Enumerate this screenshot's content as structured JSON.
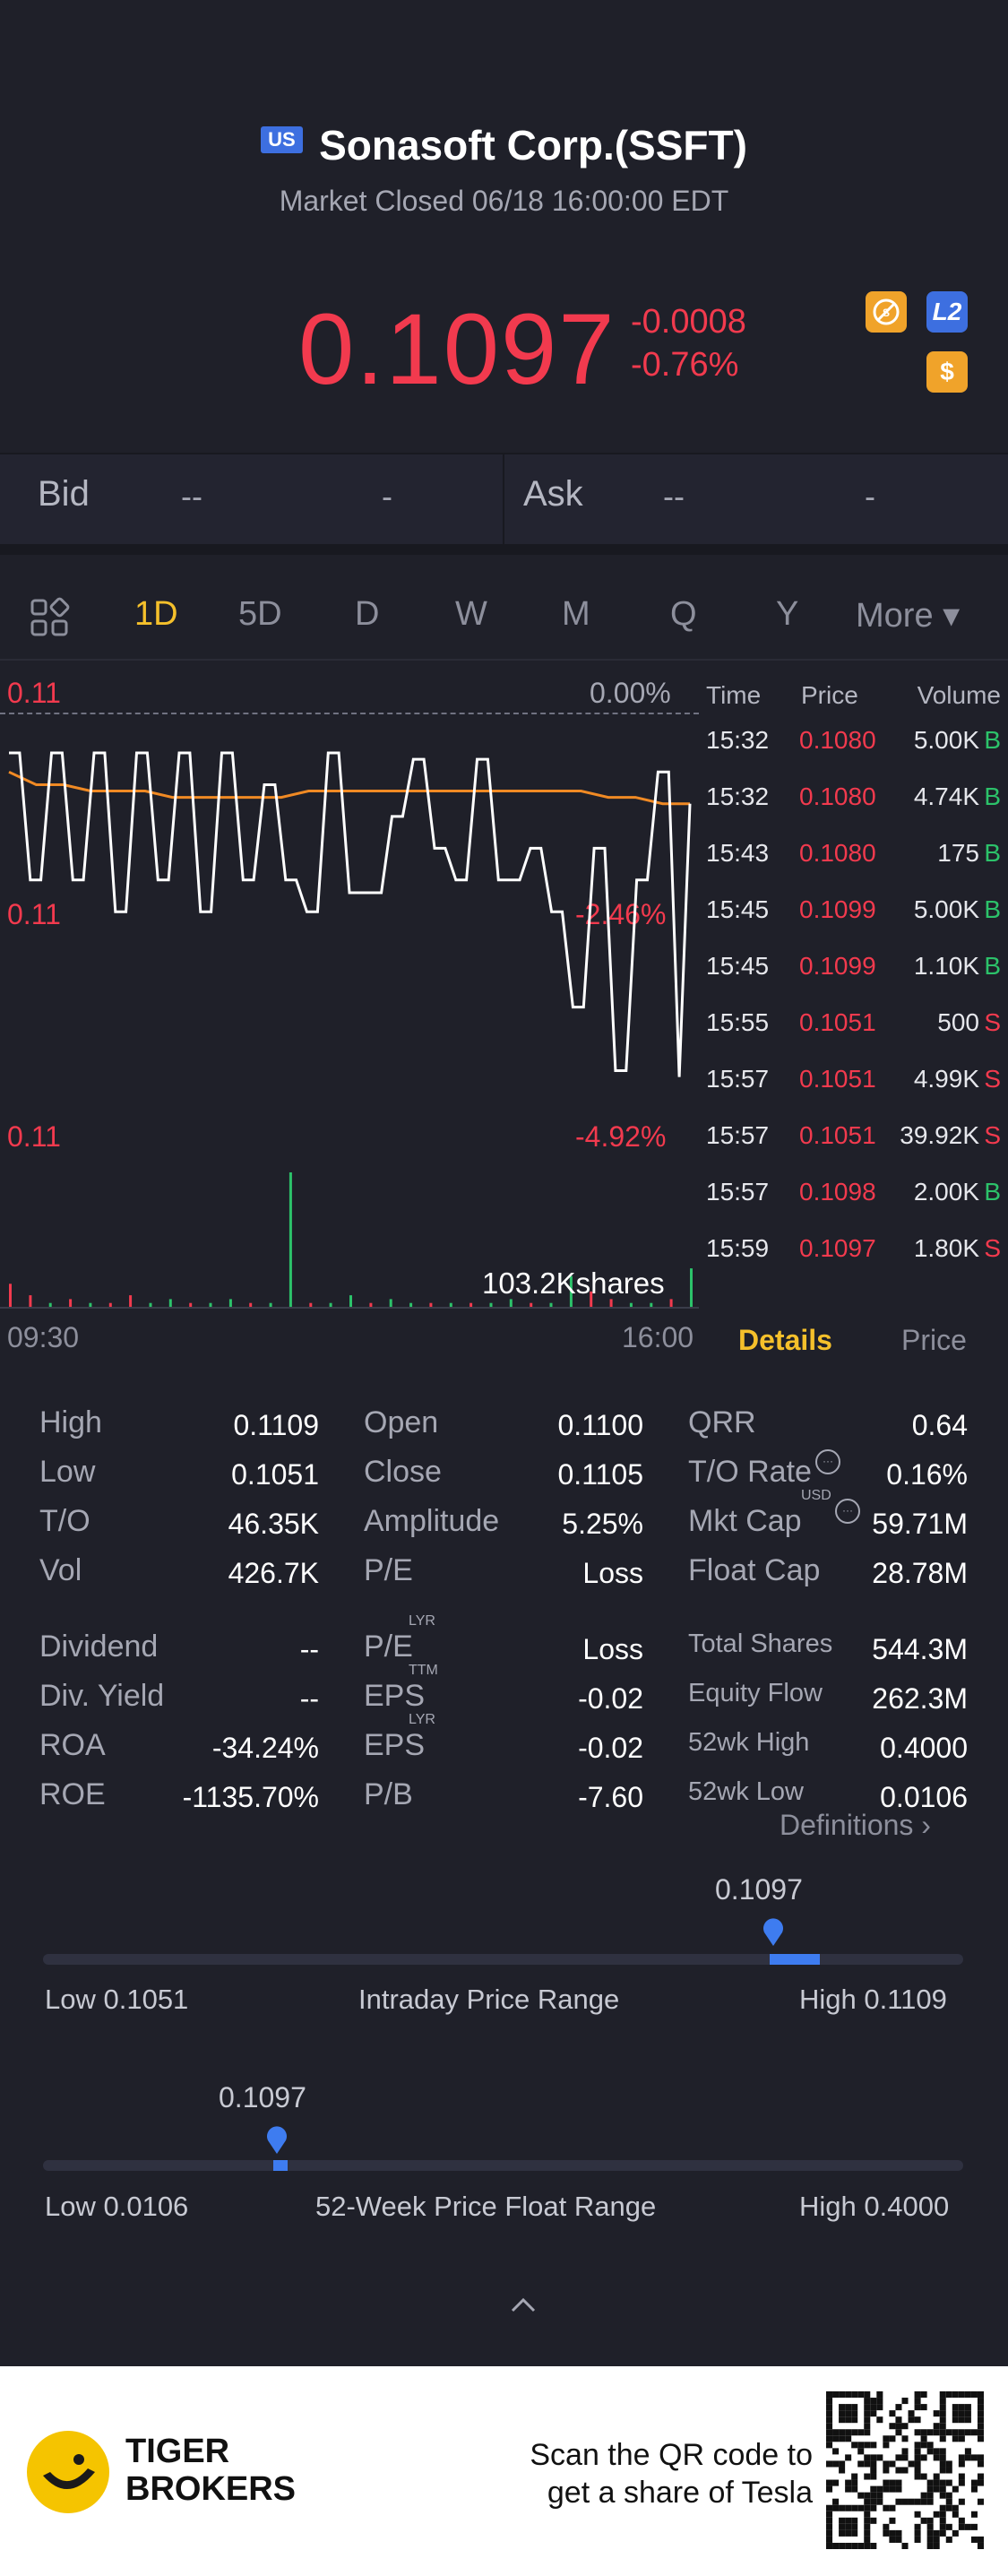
{
  "header": {
    "market_badge": "US",
    "title": "Sonasoft Corp.(SSFT)",
    "market_status": "Market Closed 06/18 16:00:00 EDT",
    "price": "0.1097",
    "change": "-0.0008",
    "change_pct": "-0.76%",
    "icons": [
      "no-short-icon",
      "level2-icon",
      "dollar-icon"
    ],
    "level2_label": "L2",
    "dollar_label": "$"
  },
  "bidask": {
    "bid_label": "Bid",
    "bid_price": "--",
    "bid_size": "-",
    "ask_label": "Ask",
    "ask_price": "--",
    "ask_size": "-"
  },
  "tabs": [
    "1D",
    "5D",
    "D",
    "W",
    "M",
    "Q",
    "Y",
    "More ▾"
  ],
  "chart": {
    "top_price": "0.11",
    "top_pct": "0.00%",
    "mid_price": "0.11",
    "mid_pct": "-2.46%",
    "low_price": "0.11",
    "low_pct": "-4.92%",
    "volume_label": "103.2Kshares",
    "time_start": "09:30",
    "time_end": "16:00",
    "price_color": "#ffffff",
    "avg_color": "#f08a24",
    "price_line": [
      0.1105,
      0.1105,
      0.1085,
      0.1085,
      0.1105,
      0.1105,
      0.1085,
      0.1085,
      0.1105,
      0.1105,
      0.108,
      0.108,
      0.1105,
      0.1105,
      0.1085,
      0.1085,
      0.1105,
      0.1105,
      0.108,
      0.108,
      0.1105,
      0.1105,
      0.1085,
      0.1085,
      0.11,
      0.11,
      0.1085,
      0.1085,
      0.108,
      0.108,
      0.1105,
      0.1105,
      0.1083,
      0.1083,
      0.1083,
      0.1083,
      0.1095,
      0.1095,
      0.1104,
      0.1104,
      0.109,
      0.109,
      0.1085,
      0.1085,
      0.1104,
      0.1104,
      0.1085,
      0.1085,
      0.1085,
      0.109,
      0.109,
      0.108,
      0.108,
      0.1065,
      0.1065,
      0.109,
      0.109,
      0.1055,
      0.1055,
      0.1085,
      0.1085,
      0.1102,
      0.1102,
      0.1054,
      0.1097
    ],
    "avg_line": [
      0.1102,
      0.11,
      0.11,
      0.1099,
      0.1099,
      0.1099,
      0.1098,
      0.1098,
      0.1098,
      0.1098,
      0.1098,
      0.1099,
      0.1099,
      0.1099,
      0.1099,
      0.1099,
      0.1099,
      0.1099,
      0.1099,
      0.1099,
      0.1099,
      0.1099,
      0.1098,
      0.1098,
      0.1097,
      0.1097
    ],
    "volumes": [
      6,
      3,
      1,
      2,
      1,
      1,
      3,
      1,
      2,
      1,
      1,
      2,
      1,
      1,
      35,
      1,
      1,
      3,
      1,
      2,
      1,
      1,
      1,
      1,
      1,
      2,
      1,
      1,
      8,
      4,
      2,
      1,
      1,
      2,
      10
    ],
    "volume_colors": [
      "r",
      "r",
      "g",
      "r",
      "g",
      "r",
      "r",
      "g",
      "g",
      "r",
      "g",
      "g",
      "r",
      "g",
      "g",
      "r",
      "g",
      "g",
      "r",
      "g",
      "g",
      "r",
      "g",
      "r",
      "g",
      "g",
      "r",
      "g",
      "g",
      "r",
      "r",
      "g",
      "g",
      "r",
      "g"
    ]
  },
  "trades": {
    "headers": [
      "Time",
      "Price",
      "Volume"
    ],
    "rows": [
      {
        "time": "15:32",
        "price": "0.1080",
        "vol": "5.00K",
        "flag": "B"
      },
      {
        "time": "15:32",
        "price": "0.1080",
        "vol": "4.74K",
        "flag": "B"
      },
      {
        "time": "15:43",
        "price": "0.1080",
        "vol": "175",
        "flag": "B"
      },
      {
        "time": "15:45",
        "price": "0.1099",
        "vol": "5.00K",
        "flag": "B"
      },
      {
        "time": "15:45",
        "price": "0.1099",
        "vol": "1.10K",
        "flag": "B"
      },
      {
        "time": "15:55",
        "price": "0.1051",
        "vol": "500",
        "flag": "S"
      },
      {
        "time": "15:57",
        "price": "0.1051",
        "vol": "4.99K",
        "flag": "S"
      },
      {
        "time": "15:57",
        "price": "0.1051",
        "vol": "39.92K",
        "flag": "S"
      },
      {
        "time": "15:57",
        "price": "0.1098",
        "vol": "2.00K",
        "flag": "B"
      },
      {
        "time": "15:59",
        "price": "0.1097",
        "vol": "1.80K",
        "flag": "S"
      }
    ],
    "tab_details": "Details",
    "tab_price": "Price"
  },
  "stats": {
    "col1": [
      {
        "label": "High",
        "value": "0.1109"
      },
      {
        "label": "Low",
        "value": "0.1051"
      },
      {
        "label": "T/O",
        "value": "46.35K"
      },
      {
        "label": "Vol",
        "value": "426.7K"
      },
      {
        "label": "Dividend",
        "value": "--"
      },
      {
        "label": "Div. Yield",
        "value": "--"
      },
      {
        "label": "ROA",
        "value": "-34.24%"
      },
      {
        "label": "ROE",
        "value": "-1135.70%"
      }
    ],
    "col2": [
      {
        "label": "Open",
        "value": "0.1100"
      },
      {
        "label": "Close",
        "value": "0.1105"
      },
      {
        "label": "Amplitude",
        "value": "5.25%"
      },
      {
        "label": "P/E",
        "value": "Loss"
      },
      {
        "label": "P/E",
        "sup": "LYR",
        "value": "Loss"
      },
      {
        "label": "EPS",
        "sup": "TTM",
        "value": "-0.02"
      },
      {
        "label": "EPS",
        "sup": "LYR",
        "value": "-0.02"
      },
      {
        "label": "P/B",
        "value": "-7.60"
      }
    ],
    "col3": [
      {
        "label": "QRR",
        "value": "0.64"
      },
      {
        "label": "T/O Rate",
        "value": "0.16%"
      },
      {
        "label": "Mkt Cap",
        "sup": "USD",
        "value": "59.71M"
      },
      {
        "label": "Float Cap",
        "value": "28.78M"
      },
      {
        "label": "Total Shares",
        "value": "544.3M"
      },
      {
        "label": "Equity Flow",
        "value": "262.3M"
      },
      {
        "label": "52wk High",
        "value": "0.4000"
      },
      {
        "label": "52wk Low",
        "value": "0.0106"
      }
    ],
    "definitions": "Definitions"
  },
  "intraday_range": {
    "current": "0.1097",
    "low_label": "Low 0.1051",
    "title": "Intraday Price Range",
    "high_label": "High 0.1109",
    "low": 0.1051,
    "high": 0.1109,
    "value": 0.1097
  },
  "week52_range": {
    "current": "0.1097",
    "low_label": "Low 0.0106",
    "title": "52-Week Price Float Range",
    "high_label": "High 0.4000",
    "low": 0.0106,
    "high": 0.4,
    "value": 0.1097
  },
  "footer": {
    "brand_line1": "TIGER",
    "brand_line2": "BROKERS",
    "promo_line1": "Scan the QR code to",
    "promo_line2": "get a share of Tesla"
  }
}
